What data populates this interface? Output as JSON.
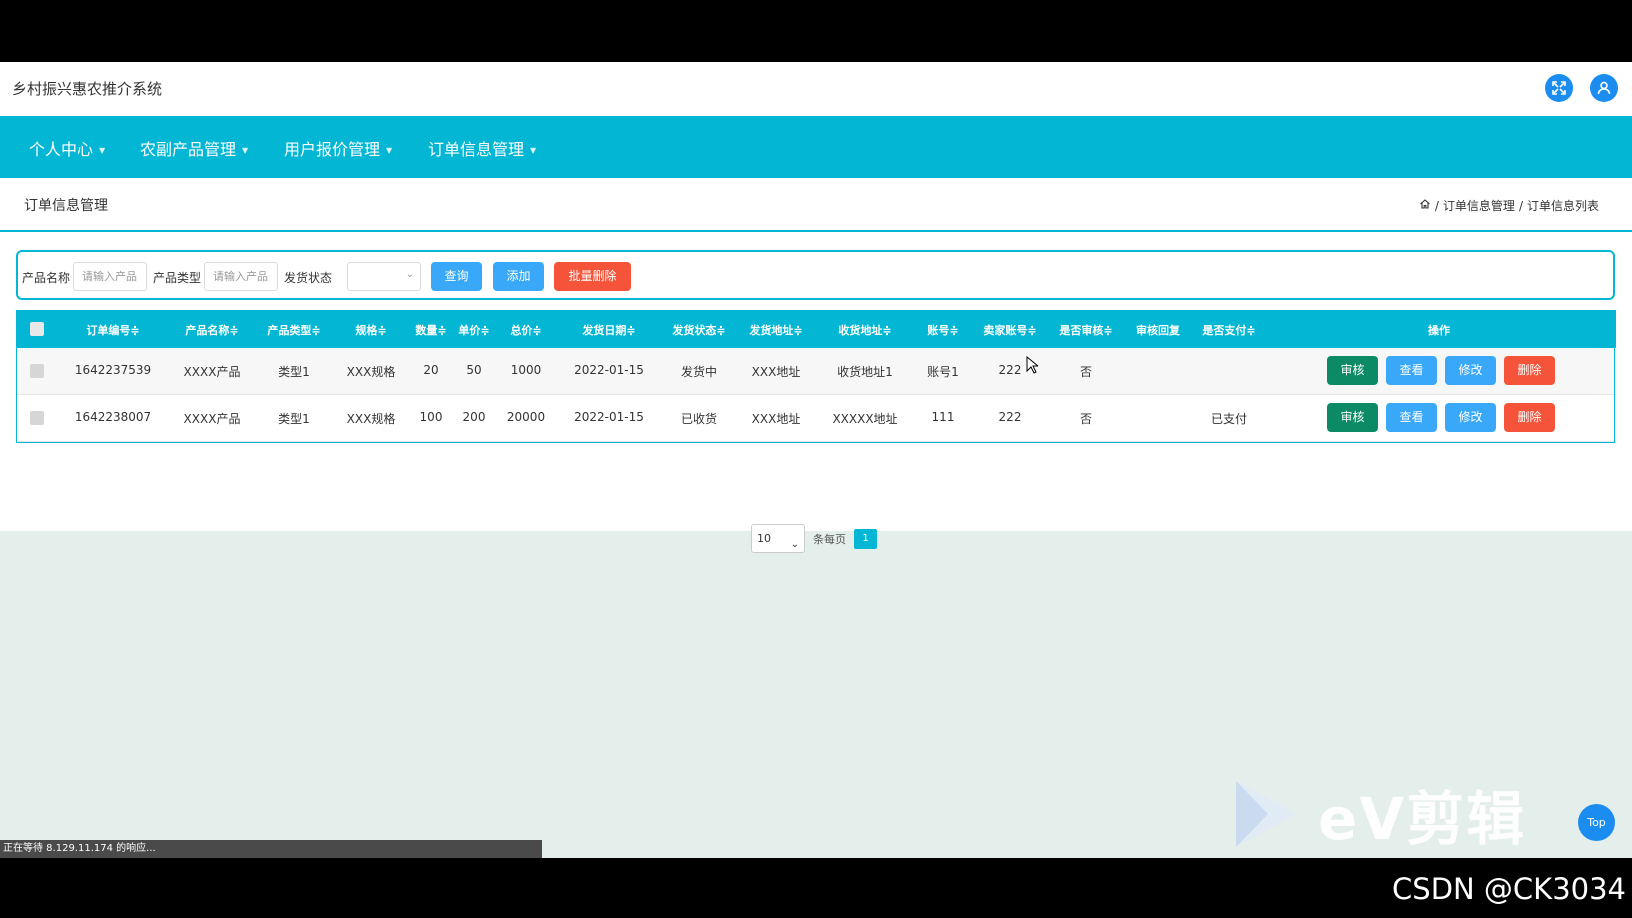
{
  "app": {
    "title": "乡村振兴惠农推介系统"
  },
  "nav": {
    "items": [
      {
        "label": "个人中心"
      },
      {
        "label": "农副产品管理"
      },
      {
        "label": "用户报价管理"
      },
      {
        "label": "订单信息管理"
      }
    ]
  },
  "page": {
    "title": "订单信息管理",
    "breadcrumb": {
      "separator": "/",
      "section": "订单信息管理",
      "current": "订单信息列表"
    }
  },
  "search": {
    "product_name_label": "产品名称",
    "product_name_placeholder": "请输入产品",
    "product_type_label": "产品类型",
    "product_type_placeholder": "请输入产品",
    "ship_status_label": "发货状态",
    "query_button": "查询",
    "add_button": "添加",
    "batch_delete_button": "批量删除"
  },
  "table": {
    "headers": {
      "order_no": "订单编号≑",
      "product_name": "产品名称≑",
      "product_type": "产品类型≑",
      "spec": "规格≑",
      "quantity": "数量≑",
      "unit_price": "单价≑",
      "total": "总价≑",
      "ship_date": "发货日期≑",
      "ship_status": "发货状态≑",
      "ship_address": "发货地址≑",
      "receive_address": "收货地址≑",
      "account": "账号≑",
      "seller_account": "卖家账号≑",
      "audited": "是否审核≑",
      "audit_reply": "审核回复",
      "paid": "是否支付≑",
      "actions": "操作"
    },
    "rows": [
      {
        "order_no": "1642237539",
        "product_name": "XXXX产品",
        "product_type": "类型1",
        "spec": "XXX规格",
        "quantity": "20",
        "unit_price": "50",
        "total": "1000",
        "ship_date": "2022-01-15",
        "ship_status": "发货中",
        "ship_address": "XXX地址",
        "receive_address": "收货地址1",
        "account": "账号1",
        "seller_account": "222",
        "audited": "否",
        "audit_reply": "",
        "paid": ""
      },
      {
        "order_no": "1642238007",
        "product_name": "XXXX产品",
        "product_type": "类型1",
        "spec": "XXX规格",
        "quantity": "100",
        "unit_price": "200",
        "total": "20000",
        "ship_date": "2022-01-15",
        "ship_status": "已收货",
        "ship_address": "XXX地址",
        "receive_address": "XXXXX地址",
        "account": "111",
        "seller_account": "222",
        "audited": "否",
        "audit_reply": "",
        "paid": "已支付"
      }
    ],
    "row_actions": {
      "audit": "审核",
      "view": "查看",
      "edit": "修改",
      "delete": "删除"
    }
  },
  "pagination": {
    "page_size": "10",
    "per_page_label": "条每页",
    "current_page": "1"
  },
  "browser": {
    "status_text": "正在等待 8.129.11.174 的响应..."
  },
  "overlay": {
    "top_button": "Top",
    "watermark": "eV剪辑",
    "credit": "CSDN @CK3034"
  },
  "icons": {
    "fullscreen": "fullscreen-icon",
    "user": "user-icon",
    "home": "home-icon",
    "chevron": "chevron-down-icon"
  },
  "colors": {
    "primary": "#03b7d4",
    "blue_button": "#1b8df0",
    "light_blue_button": "#3aa8f8",
    "red_button": "#f5543a",
    "audit_button": "#0b8a65",
    "page_bg": "#e4eeea"
  }
}
